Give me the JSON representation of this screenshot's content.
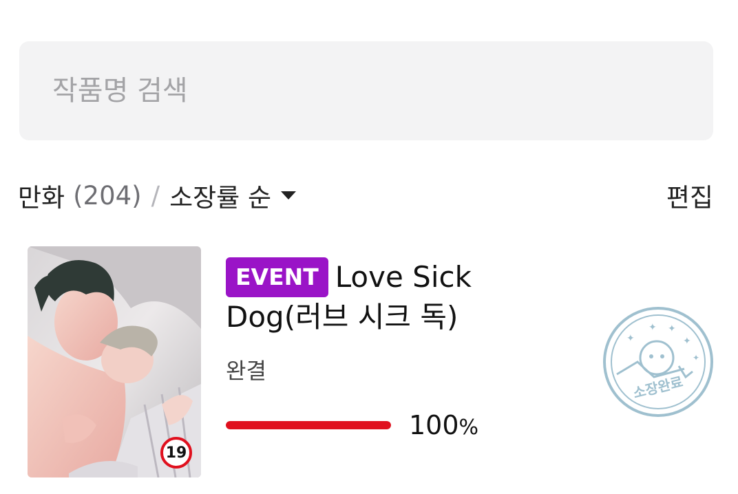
{
  "search": {
    "placeholder": "작품명 검색"
  },
  "toolbar": {
    "category": "만화",
    "count": "(204)",
    "divider": "/",
    "sort_label": "소장률 순",
    "edit_label": "편집"
  },
  "book": {
    "event_badge": "EVENT",
    "title": "Love Sick Dog(러브 시크 독)",
    "status": "완결",
    "age_rating": "19",
    "progress": {
      "value": 1.0,
      "number": "100",
      "unit": "%"
    },
    "stamp_text": "소장완료"
  },
  "colors": {
    "accent_red": "#e0101e",
    "event_purple": "#9a14c7",
    "stamp_blue": "#9fc0cf",
    "search_bg": "#f3f3f4"
  }
}
